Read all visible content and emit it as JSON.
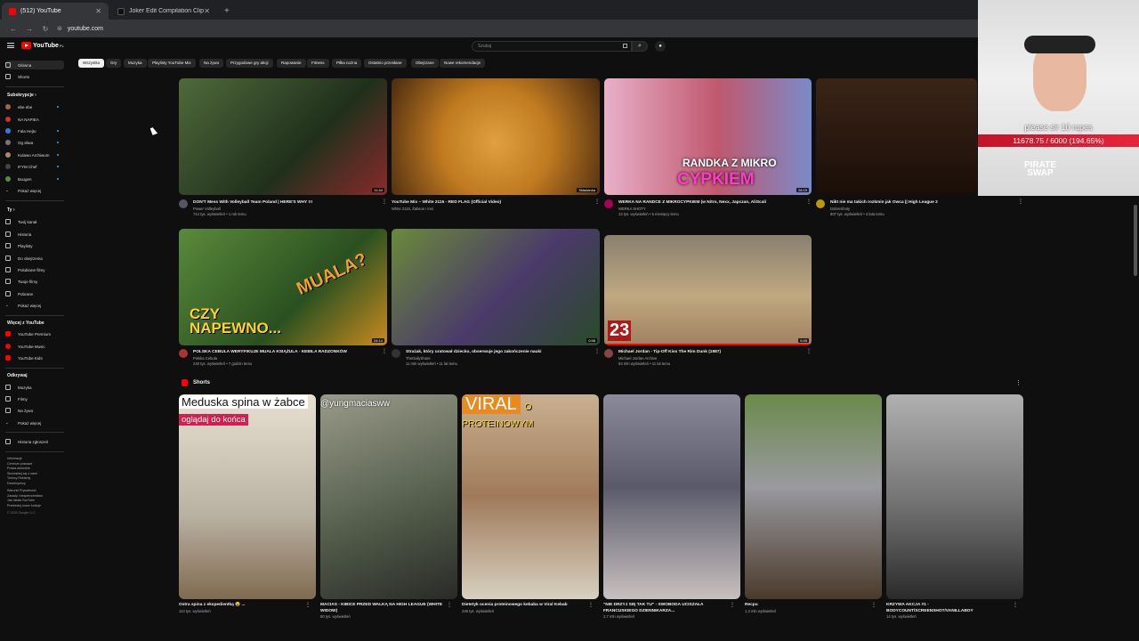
{
  "browser": {
    "tabs": [
      {
        "title": "(512) YouTube",
        "icon": "youtube-icon"
      },
      {
        "title": "Joker Edit Compilation Clips | T",
        "icon": "tiktok-icon"
      }
    ],
    "url": "youtube.com"
  },
  "header": {
    "logo_text": "YouTube",
    "logo_region": "PL",
    "search_placeholder": "Szukaj"
  },
  "sidebar": {
    "main": [
      {
        "label": "Główna",
        "active": true
      },
      {
        "label": "Shorts"
      }
    ],
    "subscriptions_title": "Subskrypcje",
    "subscriptions": [
      {
        "label": "ebe ebe",
        "color": "#9a6b4a"
      },
      {
        "label": "NA NAPIEA",
        "color": "#c0392b"
      },
      {
        "label": "Fala Hejtu",
        "color": "#2c7be5"
      },
      {
        "label": "Og sliwa",
        "color": "#777777"
      },
      {
        "label": "Kulawo Archiwum",
        "color": "#b08a5a"
      },
      {
        "label": "IFYM Chef",
        "color": "#444444"
      },
      {
        "label": "Buugen",
        "color": "#5b8c3a"
      },
      {
        "label": "Pokaż więcej",
        "icon": true
      }
    ],
    "you_title": "Ty",
    "you": [
      "Twój kanał",
      "Historia",
      "Playlisty",
      "Do obejrzenia",
      "Polubione filmy",
      "Twoje filmy",
      "Pobrane",
      "Pokaż więcej"
    ],
    "more_title": "Więcej z YouTube",
    "more": [
      "YouTube Premium",
      "YouTube Music",
      "YouTube Kids"
    ],
    "explore_title": "Odkrywaj",
    "explore": [
      "Muzyka",
      "Filmy",
      "Na żywo",
      "Pokaż więcej"
    ],
    "history": "Historia zgłoszeń",
    "footer": [
      "Informacje",
      "Centrum prasowe",
      "Prawa autorskie",
      "Skontaktuj się z nami",
      "Twórcy  Reklamy",
      "Deweloperzy",
      "Warunki  Prywatność",
      "Zasady i bezpieczeństwo",
      "Jak działa YouTube",
      "Przetestuj nowe funkcje",
      "© 2024 Google LLC"
    ]
  },
  "chips": [
    "Wszystko",
    "Gry",
    "Muzyka",
    "Playlisty YouTube Mix",
    "Na żywo",
    "Przygodowe gry akcji",
    "Rapowanie",
    "Fitness",
    "Piłka nożna",
    "Ostatnio przesłane",
    "Obejrzane",
    "Nowe rekomendacje"
  ],
  "videos": [
    {
      "title": "DON'T Mess With Volleyball Team Poland | HERE'S WHY !!!",
      "channel": "Power Volleyball",
      "stats": "714 tys. wyświetleń • 1 rok temu",
      "duration": "11:44",
      "bg": "#3a4a2c",
      "avatar": "#556"
    },
    {
      "title": "YouTube Mix – White 2115 - RED FLAG (Official Video)",
      "channel": "White 2115, Żabson i inni",
      "stats": "",
      "duration": "Składanka",
      "bg": "#8a5a1a",
      "avatar": ""
    },
    {
      "title": "WERKA NA RANDCE Z MIKROCYPKIEM (w Nitro, Nexx, Japczan, AliScali",
      "channel": "WERKA SHOTY",
      "stats": "13 tys. wyświetleń • 5 miesięcy temu",
      "duration": "26:19",
      "bg": "#c98aa8",
      "avatar": "#a05"
    },
    {
      "title": "Nikt nie ma takich rozkmin jak Owca || High League 2",
      "channel": "DobreShoty",
      "stats": "807 tys. wyświetleń • 4 lata temu",
      "duration": "",
      "bg": "#2a1c14",
      "avatar": "#b90"
    },
    {
      "title": "POLSKA CEBULA WERYFIKUJE MUALA KSIĄŻULA - KEBILA RADZONKÓW",
      "channel": "Polska Cebula",
      "stats": "240 tys. wyświetleń • 7 godzin temu",
      "duration": "24:14",
      "bg": "#3a6a2a",
      "avatar": "#a33"
    },
    {
      "title": "Strażak, który uratował dziecko, obserwuje jego zakończenie nauki",
      "channel": "TheDailyShare",
      "stats": "11 mln wyświetleń • 11 lat temu",
      "duration": "0:58",
      "bg": "#5a6a3a",
      "avatar": "#333"
    },
    {
      "title": "Michael Jordan - Tip-Off Kiss The Rim Dunk (1987)",
      "channel": "Michael Jordan Archive",
      "stats": "63 mln wyświetleń • 11 lat temu",
      "duration": "0:45",
      "bg": "#a8946a",
      "avatar": "#844"
    }
  ],
  "shorts_title": "Shorts",
  "shorts": [
    {
      "title": "Ostra spina z ekspedientką 😂 ...",
      "stats": "113 tys. wyświetleń",
      "caption": "Meduska spina w żabce",
      "caption2": "oglądaj do końca",
      "bg": "#d8d0c0"
    },
    {
      "title": "MACIAS - KIBICE PRZED WALKĄ NA HIGH LEAGUE (WHITE WIDOW)",
      "stats": "80 tys. wyświetleń",
      "caption": "@yungmaciasww",
      "caption2": "",
      "bg": "#7a7a6a"
    },
    {
      "title": "Dietetyk ocenia proteinowego kebaba w Viral Kebab",
      "stats": "249 tys. wyświetleń",
      "caption": "O PROTEINOWYM",
      "caption2": "VIRAL",
      "bg": "#a89070"
    },
    {
      "title": "\"NIE DRZYJ SIĘ TAK TU\" - SWOBODA UCISZAŁA FRANCUSKIEGO DZIENNIKARZA...",
      "stats": "2,7 mln wyświetleń",
      "caption": "",
      "caption2": "",
      "bg": "#6a6a7a"
    },
    {
      "title": "Recpu",
      "stats": "1,3 mln wyświetleń",
      "caption": "",
      "caption2": "",
      "bg": "#5a7a3a"
    },
    {
      "title": "KRZYWA AKCJA #1 - BODYCOUNT/SCREENSHOT/VANILLABOY",
      "stats": "14 tys. wyświetleń",
      "caption": "",
      "caption2": "",
      "bg": "#9a9a9a"
    }
  ],
  "overlay": {
    "donation_text": "please sir 10 rupes",
    "goal_text": "11678.75 / 6000 (194.65%)",
    "goal_fraction": 1.9465,
    "sponsor": "PIRATE SWAP"
  }
}
